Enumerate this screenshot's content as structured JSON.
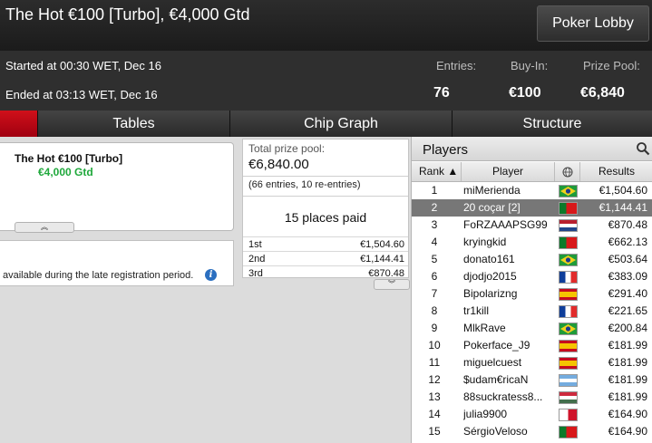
{
  "header": {
    "title": "The Hot €100 [Turbo], €4,000 Gtd",
    "lobby_button": "Poker Lobby"
  },
  "info": {
    "started": "Started at 00:30 WET, Dec 16",
    "ended": "Ended at 03:13 WET, Dec 16",
    "entries_label": "Entries:",
    "entries_value": "76",
    "buyin_label": "Buy-In:",
    "buyin_value": "€100",
    "prizepool_label": "Prize Pool:",
    "prizepool_value": "€6,840"
  },
  "tabs": [
    "",
    "Tables",
    "Chip Graph",
    "Structure"
  ],
  "tournament_card": {
    "name": "The Hot €100 [Turbo]",
    "guarantee": "€4,000 Gtd",
    "collapse_glyph": "︽"
  },
  "notice": {
    "text": "available during the late registration period.",
    "icon": "info-icon"
  },
  "prize_panel": {
    "total_label": "Total prize pool:",
    "total_value": "€6,840.00",
    "entries_text": "(66 entries, 10 re-entries)",
    "places_paid": "15 places paid",
    "rows": [
      {
        "place": "1st",
        "amount": "€1,504.60"
      },
      {
        "place": "2nd",
        "amount": "€1,144.41"
      },
      {
        "place": "3rd",
        "amount": "€870.48"
      }
    ],
    "expand_glyph": "︾"
  },
  "players_panel": {
    "title": "Players",
    "columns": {
      "rank": "Rank ▲",
      "player": "Player",
      "results": "Results"
    },
    "selected_index": 1,
    "rows": [
      {
        "rank": "1",
        "name": "miMerienda",
        "flag": "br",
        "result": "€1,504.60"
      },
      {
        "rank": "2",
        "name": "20 coçar [2]",
        "flag": "pt",
        "result": "€1,144.41"
      },
      {
        "rank": "3",
        "name": "FoRZAAAPSG99",
        "flag": "nl",
        "result": "€870.48"
      },
      {
        "rank": "4",
        "name": "kryingkid",
        "flag": "pt",
        "result": "€662.13"
      },
      {
        "rank": "5",
        "name": "donato161",
        "flag": "br",
        "result": "€503.64"
      },
      {
        "rank": "6",
        "name": "djodjo2015",
        "flag": "fr",
        "result": "€383.09"
      },
      {
        "rank": "7",
        "name": "Bipolarizng",
        "flag": "es",
        "result": "€291.40"
      },
      {
        "rank": "8",
        "name": "tr1kill",
        "flag": "fr",
        "result": "€221.65"
      },
      {
        "rank": "9",
        "name": "MlkRave",
        "flag": "br",
        "result": "€200.84"
      },
      {
        "rank": "10",
        "name": "Pokerface_J9",
        "flag": "es",
        "result": "€181.99"
      },
      {
        "rank": "11",
        "name": "miguelcuest",
        "flag": "es",
        "result": "€181.99"
      },
      {
        "rank": "12",
        "name": "$udam€ricaN",
        "flag": "ar",
        "result": "€181.99"
      },
      {
        "rank": "13",
        "name": "88suckratess8...",
        "flag": "hu",
        "result": "€181.99"
      },
      {
        "rank": "14",
        "name": "julia9900",
        "flag": "mt",
        "result": "€164.90"
      },
      {
        "rank": "15",
        "name": "SérgioVeloso",
        "flag": "pt",
        "result": "€164.90"
      }
    ]
  }
}
